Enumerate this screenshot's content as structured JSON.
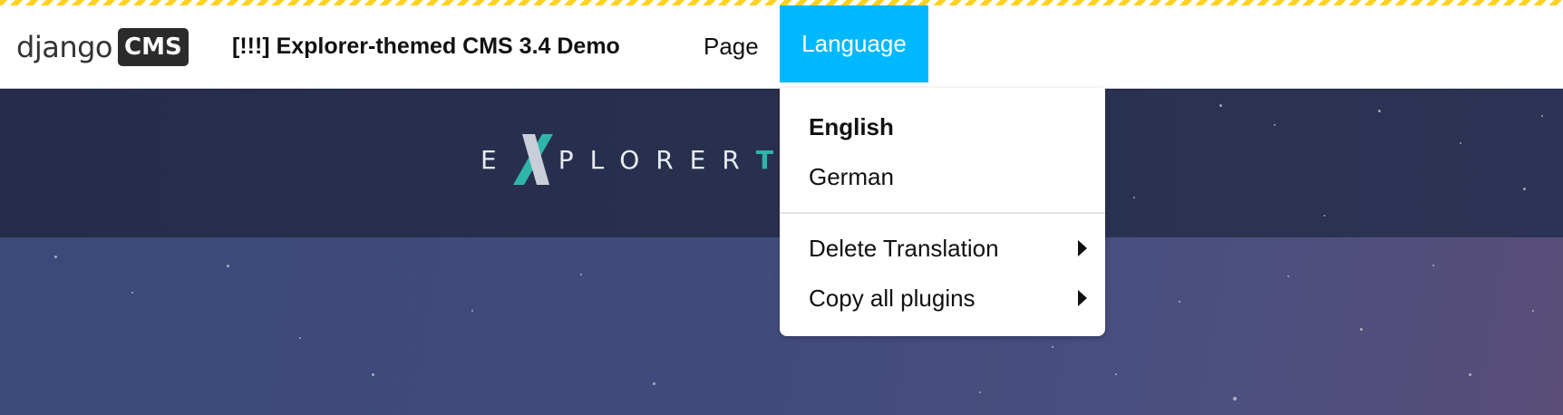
{
  "toolbar": {
    "logo_django": "django",
    "logo_cms": "CMS",
    "site_title": "[!!!] Explorer-themed CMS 3.4 Demo",
    "menu_page": "Page",
    "menu_language": "Language"
  },
  "language_menu": {
    "items": [
      {
        "label": "English",
        "active": true
      },
      {
        "label": "German"
      }
    ],
    "actions": [
      {
        "label": "Delete Translation",
        "submenu": true
      },
      {
        "label": "Copy all plugins",
        "submenu": true
      }
    ]
  },
  "hero": {
    "brand_prefix": "E",
    "brand_main": "PLORER",
    "brand_accent": "TH"
  },
  "colors": {
    "accent": "#00b8ff",
    "hazard": "#ffd21f",
    "brand_teal": "#2fb6a8"
  },
  "icons": {
    "submenu_arrow": "caret-right-icon",
    "brand_mark": "x-logo-icon"
  }
}
